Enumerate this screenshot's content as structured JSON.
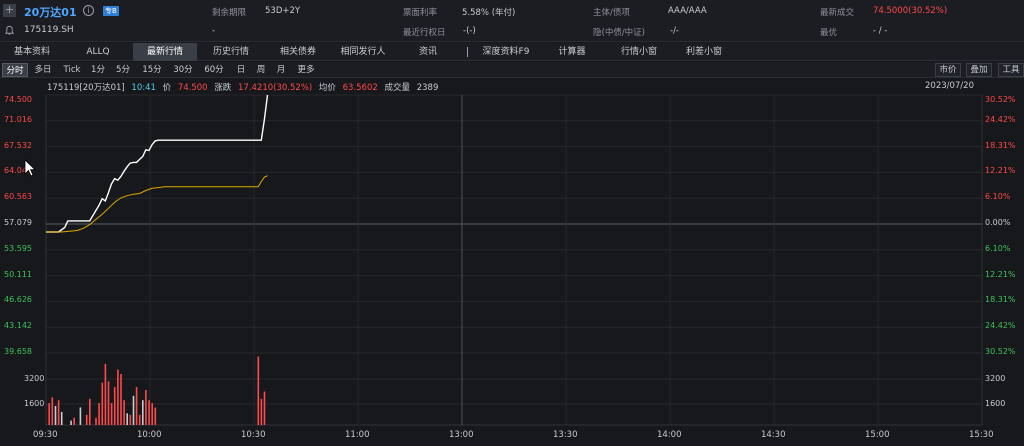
{
  "header": {
    "bond_name": "20万达01",
    "info_icon": "i",
    "tag": "专B",
    "bond_code": "175119.SH",
    "row1": [
      {
        "label": "剩余期限",
        "value": "53D+2Y",
        "red": false
      },
      {
        "label": "票面利率",
        "value": "5.58% (年付)",
        "red": false
      },
      {
        "label": "主体/债项",
        "value": "AAA/AAA",
        "red": false
      },
      {
        "label": "最新成交",
        "value": "74.5000(30.52%)",
        "red": true
      }
    ],
    "row2": [
      {
        "label": "",
        "value": "-",
        "red": false
      },
      {
        "label": "最近行权日",
        "value": "-(-)",
        "red": false
      },
      {
        "label": "隐(中债/中证)",
        "value": "-/-",
        "red": false
      },
      {
        "label": "最优",
        "value": "- / -",
        "red": false
      }
    ]
  },
  "tabs": [
    "基本资料",
    "ALLQ",
    "最新行情",
    "历史行情",
    "相关债券",
    "相同发行人",
    "资讯",
    "深度资料F9",
    "计算器",
    "行情小窗",
    "利差小窗"
  ],
  "active_tab": "最新行情",
  "periods": [
    "分时",
    "多日",
    "Tick",
    "1分",
    "5分",
    "15分",
    "30分",
    "60分",
    "日",
    "周",
    "月",
    "更多"
  ],
  "active_period": "分时",
  "right_buttons": [
    "市价",
    "叠加",
    "工具"
  ],
  "quote": {
    "code_name": "175119[20万达01]",
    "time": "10:41",
    "price_label": "价",
    "price": "74.500",
    "change_label": "涨跌",
    "change": "17.4210(30.52%)",
    "avg_label": "均价",
    "avg": "63.5602",
    "vol_label": "成交量",
    "vol": "2389",
    "date": "2023/07/20"
  },
  "colors": {
    "price_line": "#ffffff",
    "avg_line": "#e0a800",
    "up": "#ff4a4a",
    "down": "#3ec25a",
    "neutral": "#c8cbd0"
  },
  "chart_data": {
    "type": "line",
    "base_price": 57.079,
    "price_axis": [
      "74.500",
      "71.016",
      "67.532",
      "64.047",
      "60.563",
      "57.079",
      "53.595",
      "50.111",
      "46.626",
      "43.142",
      "39.658"
    ],
    "pct_axis": [
      "30.52%",
      "24.42%",
      "18.31%",
      "12.21%",
      "6.10%",
      "0.00%",
      "6.10%",
      "12.21%",
      "18.31%",
      "24.42%",
      "30.52%"
    ],
    "volume_axis": [
      "3200",
      "1600"
    ],
    "x_ticks": [
      "09:30",
      "10:00",
      "10:30",
      "11:00",
      "13:00",
      "13:30",
      "14:00",
      "14:30",
      "15:00",
      "15:30"
    ],
    "series": [
      {
        "name": "价",
        "x": [
          0,
          2,
          4,
          6,
          7,
          8,
          9,
          10,
          11,
          12,
          13,
          14,
          15,
          16,
          17,
          18,
          19,
          20,
          21,
          22,
          23,
          24,
          25,
          26,
          27,
          28,
          29,
          30,
          31,
          32,
          33,
          34,
          35,
          36,
          37,
          38,
          39,
          40,
          41,
          42,
          43,
          44,
          45,
          46,
          47,
          48,
          49,
          50,
          51,
          52,
          53,
          54,
          55,
          56,
          57,
          58,
          59,
          60,
          61,
          62,
          63,
          64,
          65,
          66,
          67,
          68,
          69,
          70,
          71
        ],
        "y": [
          56.0,
          56.0,
          56.0,
          56.6,
          57.5,
          57.5,
          57.5,
          57.5,
          57.5,
          57.5,
          57.5,
          57.5,
          58.2,
          58.9,
          59.6,
          60.5,
          60.2,
          61.3,
          62.5,
          63.2,
          63.0,
          63.5,
          64.2,
          64.8,
          65.3,
          65.4,
          65.4,
          65.8,
          66.2,
          67.1,
          67.0,
          67.8,
          68.3,
          68.4,
          68.4,
          68.4,
          68.4,
          68.4,
          68.4,
          68.4,
          68.4,
          68.4,
          68.4,
          68.4,
          68.4,
          68.4,
          68.4,
          68.4,
          68.4,
          68.4,
          68.4,
          68.4,
          68.4,
          68.4,
          68.4,
          68.4,
          68.4,
          68.4,
          68.4,
          68.4,
          68.4,
          68.4,
          68.4,
          68.4,
          68.4,
          68.4,
          68.4,
          71.2,
          74.5
        ]
      },
      {
        "name": "均价",
        "x": [
          0,
          5,
          10,
          12,
          14,
          16,
          18,
          20,
          22,
          24,
          26,
          28,
          30,
          32,
          34,
          36,
          38,
          40,
          45,
          50,
          55,
          60,
          65,
          68,
          69,
          70,
          71
        ],
        "y": [
          56.0,
          56.0,
          56.2,
          56.5,
          57.0,
          57.7,
          58.4,
          59.2,
          60.0,
          60.6,
          60.9,
          61.1,
          61.2,
          61.6,
          61.9,
          62.0,
          62.1,
          62.1,
          62.1,
          62.1,
          62.1,
          62.1,
          62.1,
          62.1,
          62.8,
          63.4,
          63.6
        ]
      }
    ],
    "volume": {
      "x": [
        1,
        2,
        3,
        4,
        5,
        8,
        9,
        11,
        13,
        14,
        16,
        17,
        18,
        19,
        20,
        21,
        22,
        23,
        24,
        25,
        26,
        27,
        28,
        29,
        30,
        31,
        32,
        33,
        34,
        35,
        68,
        69,
        70
      ],
      "values": [
        1500,
        1900,
        1300,
        1700,
        900,
        300,
        500,
        1200,
        700,
        1800,
        500,
        1500,
        2900,
        4200,
        3000,
        1500,
        2600,
        3800,
        3500,
        1700,
        800,
        700,
        2000,
        2600,
        700,
        1700,
        2400,
        1700,
        1500,
        1200,
        4700,
        1800,
        2300
      ],
      "colors": [
        "u",
        "u",
        "n",
        "u",
        "n",
        "n",
        "u",
        "n",
        "u",
        "u",
        "u",
        "u",
        "u",
        "u",
        "u",
        "u",
        "u",
        "u",
        "u",
        "u",
        "n",
        "u",
        "n",
        "u",
        "u",
        "n",
        "u",
        "u",
        "u",
        "u",
        "u",
        "u",
        "u"
      ],
      "ylim": [
        0,
        4800
      ]
    },
    "ylim": [
      39.658,
      74.5
    ],
    "xlim": [
      0,
      300
    ]
  },
  "icons": {
    "plus": "plus-icon",
    "bell": "bell-icon",
    "info": "info-icon",
    "cursor": "mouse-cursor-icon"
  }
}
